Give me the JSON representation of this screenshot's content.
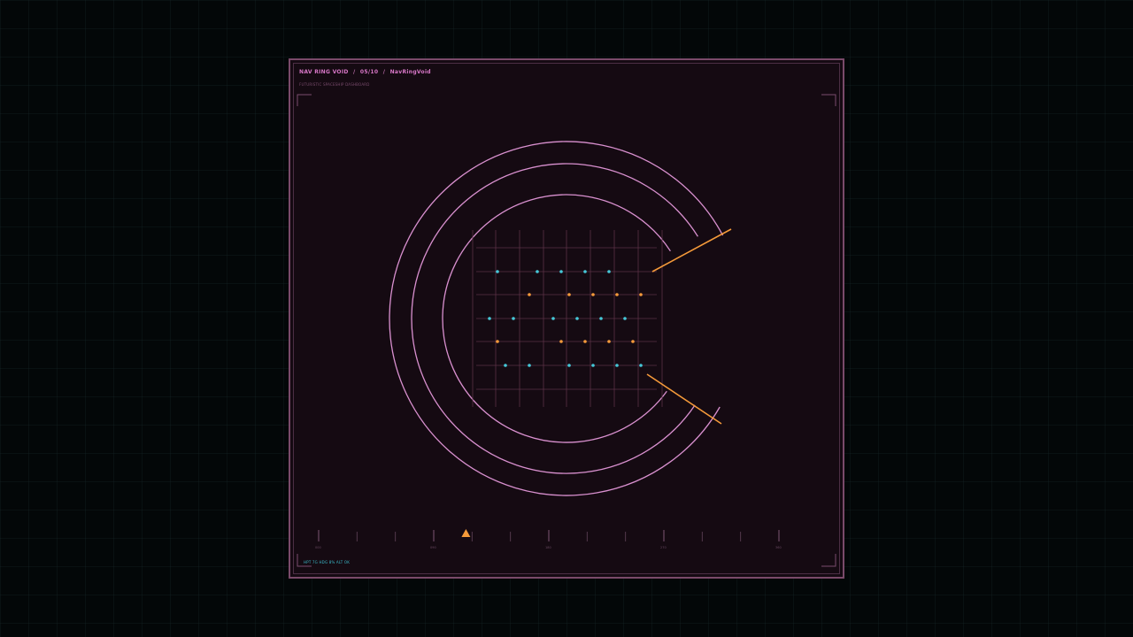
{
  "header": {
    "name": "NAV RING VOID",
    "index": "05/10",
    "component": "NavRingVoid",
    "subtitle": "FUTURISTIC SPACESHIP DASHBOARD"
  },
  "status_readout": "HPT 7G  HDG 8%  ALT OK",
  "scale": {
    "labels": [
      "000",
      "090",
      "180",
      "270",
      "360"
    ],
    "marker_position": 0.32
  },
  "dot_grid": {
    "cols": 7,
    "rows": 5,
    "pattern": [
      "c.cccc.",
      ".o.oooo",
      "cc.cccc",
      "o.oo.oo",
      ".cc.ccc"
    ]
  },
  "colors": {
    "background": "#030708",
    "panel": "#150a12",
    "frame": "#7a4a6a",
    "accent_pink": "#d990cf",
    "accent_orange": "#f59a3a",
    "accent_cyan": "#45c8d8",
    "grid_line": "#5a3046"
  }
}
